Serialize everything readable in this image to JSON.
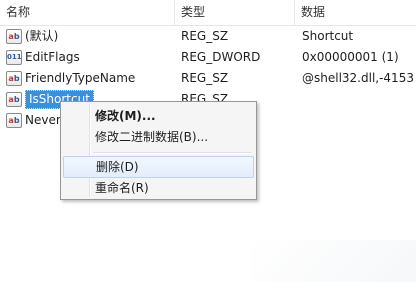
{
  "columns": {
    "name": "名称",
    "type": "类型",
    "data": "数据"
  },
  "rows": [
    {
      "name": "(默认)",
      "type": "REG_SZ",
      "data": "Shortcut",
      "icon": "string-value-icon"
    },
    {
      "name": "EditFlags",
      "type": "REG_DWORD",
      "data": "0x00000001 (1)",
      "icon": "binary-value-icon"
    },
    {
      "name": "FriendlyTypeName",
      "type": "REG_SZ",
      "data": "@shell32.dll,-4153",
      "icon": "string-value-icon"
    },
    {
      "name": "IsShortcut",
      "type": "REG_SZ",
      "data": "",
      "icon": "string-value-icon",
      "selected": true
    },
    {
      "name": "Never",
      "type": "",
      "data": "",
      "icon": "string-value-icon"
    }
  ],
  "context_menu": {
    "items": [
      {
        "label": "修改(M)...",
        "bold": true
      },
      {
        "label": "修改二进制数据(B)..."
      },
      {
        "label": "删除(D)",
        "hovered": true
      },
      {
        "label": "重命名(R)"
      }
    ]
  },
  "colors": {
    "selection": "#3c8fd9",
    "menu_background": "#f5f5f5",
    "menu_hover": "#e2eefb"
  }
}
